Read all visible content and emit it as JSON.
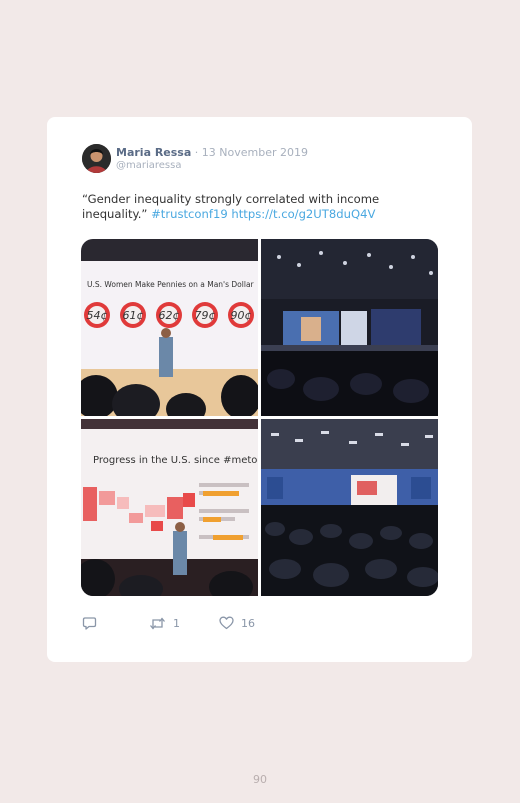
{
  "tweet": {
    "author_name": "Maria Ressa",
    "separator": " · ",
    "date": "13 November 2019",
    "handle": "@mariaressa",
    "text": "“Gender inequality strongly correlated with income inequality.” ",
    "hashtag": "#trustconf19",
    "url": "https://t.co/g2UT8duQ4V",
    "photos": [
      {
        "slide_title": "U.S. Women Make Pennies on a Man's Dollar",
        "values": [
          "54¢",
          "61¢",
          "62¢",
          "79¢",
          "90¢"
        ]
      },
      {
        "scene": "stage"
      },
      {
        "slide_title": "Progress in the U.S. since #metoo"
      },
      {
        "scene": "hall"
      }
    ],
    "actions": {
      "reply_icon": "reply-icon",
      "retweet_icon": "retweet-icon",
      "retweet_count": "1",
      "like_icon": "heart-icon",
      "like_count": "16"
    },
    "colors": {
      "link": "#4aa8e0",
      "name": "#5a6b86",
      "muted": "#a8b0bd"
    }
  },
  "page": {
    "number": "90"
  }
}
